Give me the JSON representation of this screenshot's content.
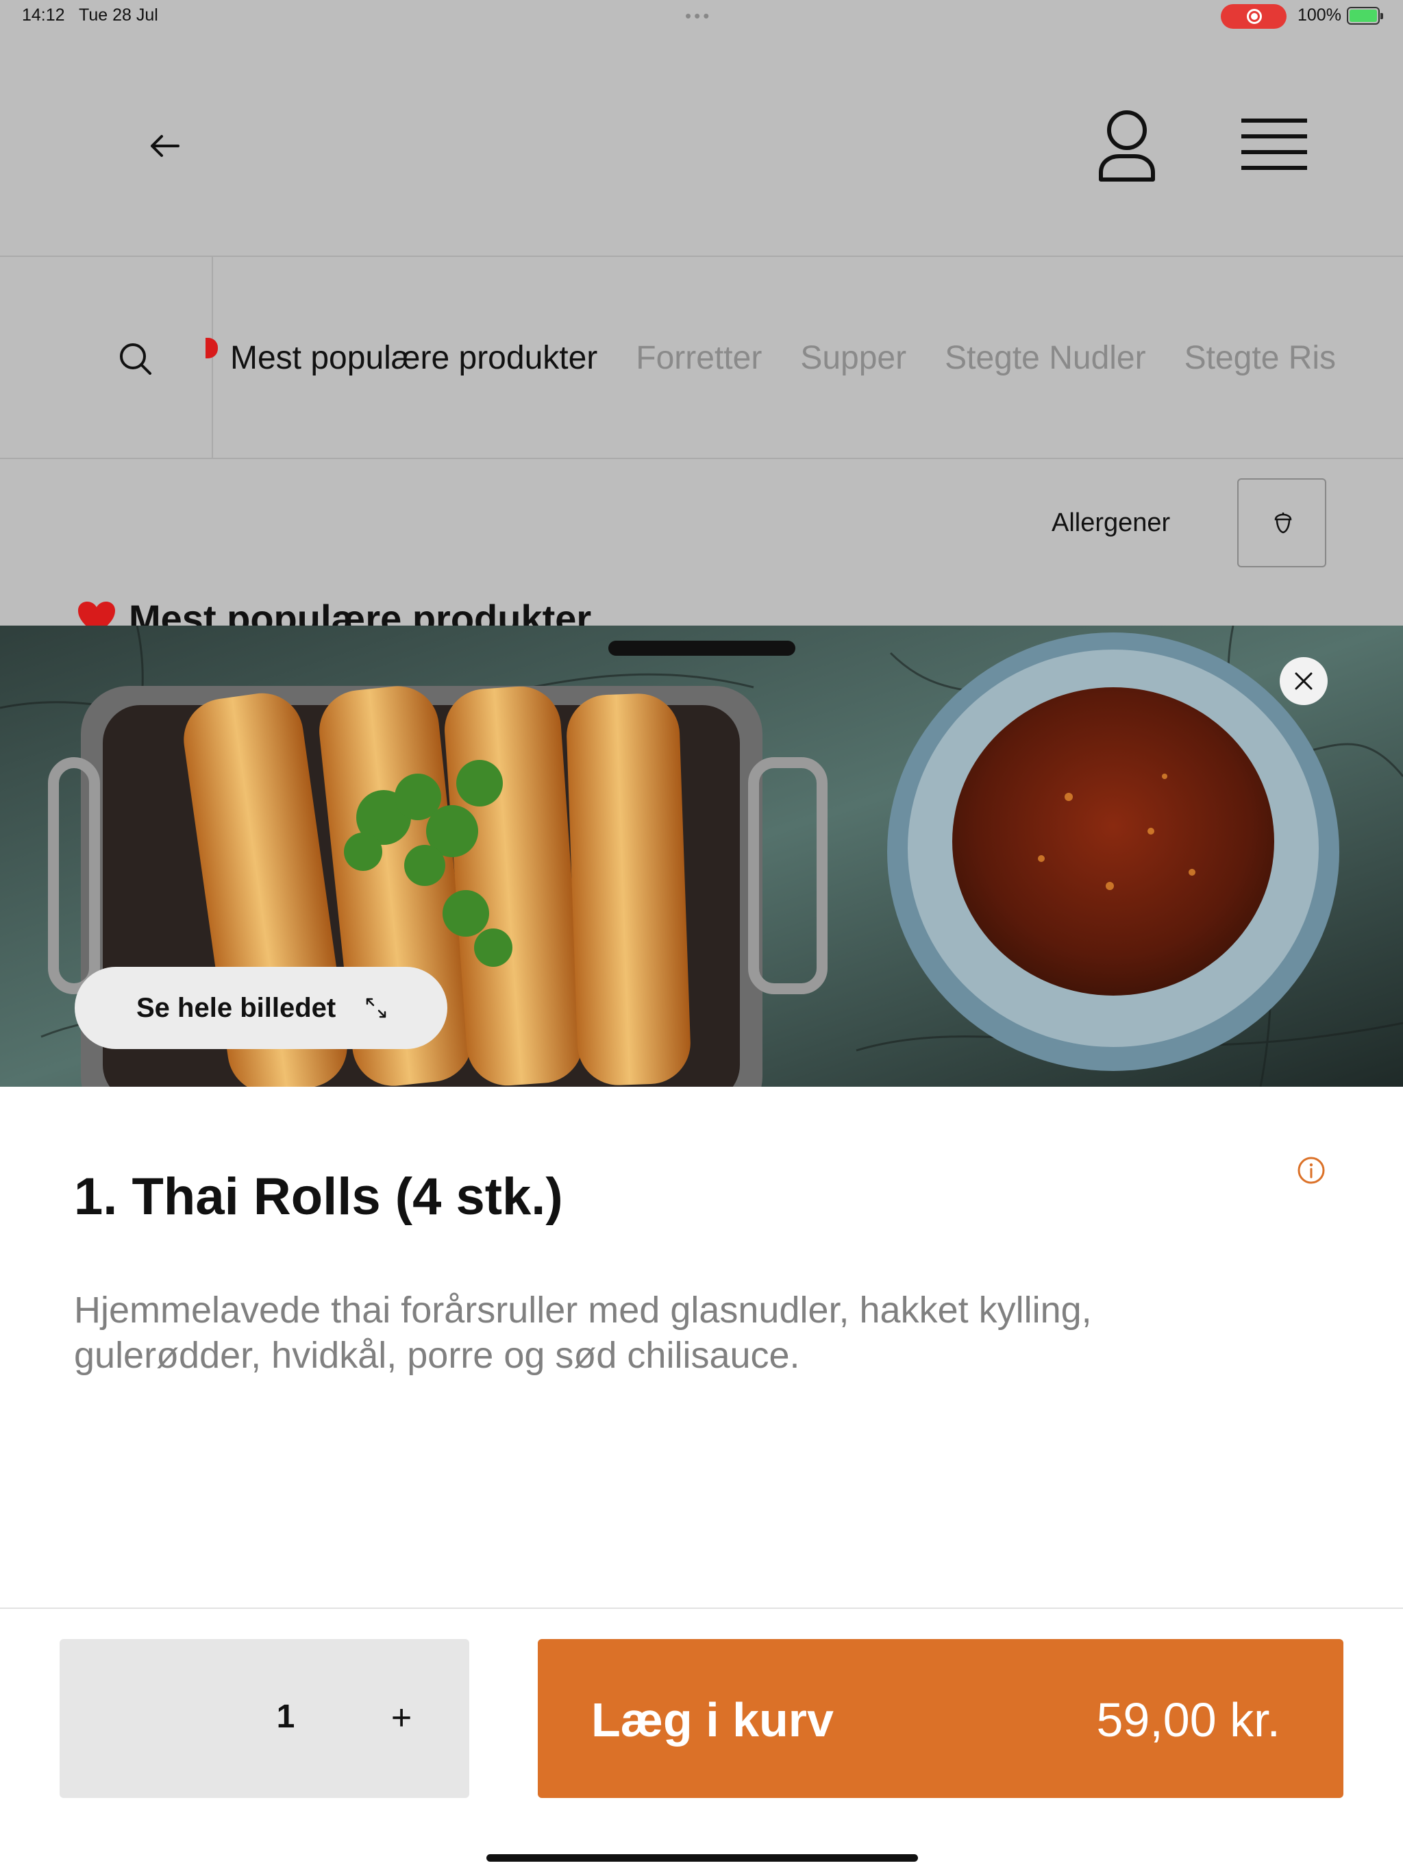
{
  "status_bar": {
    "time": "14:12",
    "date": "Tue 28 Jul",
    "battery": "100%"
  },
  "header": {
    "back_icon": "arrow-left-icon",
    "user_icon": "user-icon",
    "menu_icon": "hamburger-menu-icon"
  },
  "categories": {
    "items": [
      {
        "label": "Mest populære produkter",
        "active": true
      },
      {
        "label": "Forretter",
        "active": false
      },
      {
        "label": "Supper",
        "active": false
      },
      {
        "label": "Stegte Nudler",
        "active": false
      },
      {
        "label": "Stegte Ris",
        "active": false
      }
    ]
  },
  "allergens": {
    "label": "Allergener",
    "icon": "acorn-icon"
  },
  "section": {
    "title": "Mest populære produkter"
  },
  "product": {
    "full_image_label": "Se hele billedet",
    "title": "1. Thai Rolls (4 stk.)",
    "description": "Hjemmelavede thai forårsruller med glasnudler, hakket kylling, gulerødder, hvidkål, porre og sød chilisauce."
  },
  "footer": {
    "quantity": "1",
    "plus": "+",
    "add_label": "Læg i kurv",
    "price": "59,00 kr."
  },
  "colors": {
    "accent": "#db7128",
    "overlay": "#bdbdbd"
  }
}
